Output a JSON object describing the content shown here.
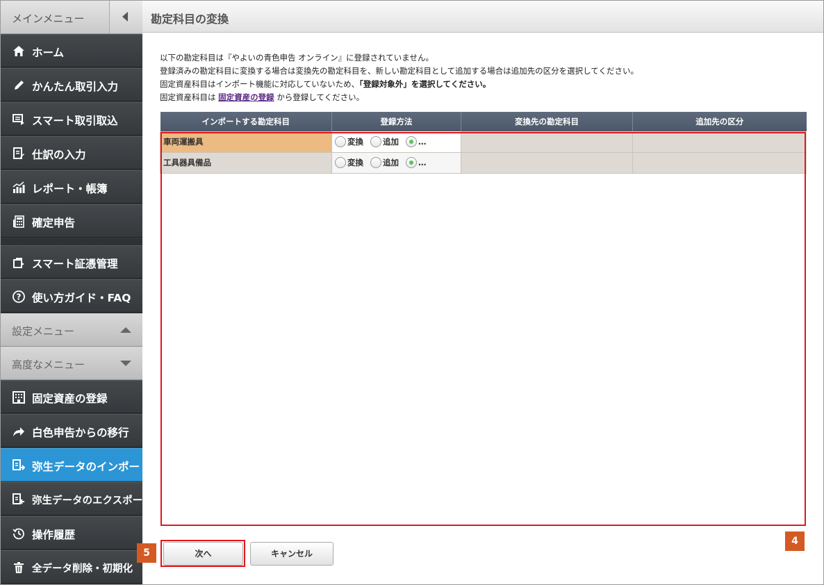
{
  "sidebar": {
    "menu_title": "メインメニュー",
    "items": [
      {
        "label": "ホーム",
        "icon": "home-icon"
      },
      {
        "label": "かんたん取引入力",
        "icon": "pencil-icon"
      },
      {
        "label": "スマート取引取込",
        "icon": "import-icon"
      },
      {
        "label": "仕訳の入力",
        "icon": "journal-icon"
      },
      {
        "label": "レポート・帳簿",
        "icon": "chart-icon"
      },
      {
        "label": "確定申告",
        "icon": "calculator-icon"
      },
      {
        "label": "スマート証憑管理",
        "icon": "receipt-icon"
      },
      {
        "label": "使い方ガイド・FAQ",
        "icon": "help-icon"
      }
    ],
    "settings_title": "設定メニュー",
    "advanced_title": "高度なメニュー",
    "advanced_items": [
      {
        "label": "固定資産の登録",
        "icon": "building-icon"
      },
      {
        "label": "白色申告からの移行",
        "icon": "share-arrow-icon"
      },
      {
        "label": "弥生データのインポート",
        "icon": "data-import-icon"
      },
      {
        "label": "弥生データのエクスポート",
        "icon": "data-export-icon"
      },
      {
        "label": "操作履歴",
        "icon": "history-icon"
      },
      {
        "label": "全データ削除・初期化",
        "icon": "trash-icon"
      }
    ]
  },
  "page": {
    "title": "勘定科目の変換",
    "intro_line1": "以下の勘定科目は『やよいの青色申告 オンライン』に登録されていません。",
    "intro_line2": "登録済みの勘定科目に変換する場合は変換先の勘定科目を、新しい勘定科目として追加する場合は追加先の区分を選択してください。",
    "intro_line3_pre": "固定資産科目はインポート機能に対応していないため、",
    "intro_line3_bold": "「登録対象外」を選択してください。",
    "intro_line4_pre": "固定資産科目は",
    "intro_line4_link": "固定資産の登録",
    "intro_line4_post": "から登録してください。"
  },
  "table": {
    "headers": [
      "インポートする勘定科目",
      "登録方法",
      "変換先の勘定科目",
      "追加先の区分"
    ],
    "rows": [
      {
        "name": "車両運搬具",
        "opt_convert": "変換",
        "opt_add": "追加",
        "opt_other": "…",
        "target": "",
        "category": ""
      },
      {
        "name": "工具器具備品",
        "opt_convert": "変換",
        "opt_add": "追加",
        "opt_other": "…",
        "target": "",
        "category": ""
      }
    ]
  },
  "buttons": {
    "next": "次へ",
    "cancel": "キャンセル"
  },
  "badges": {
    "step4": "4",
    "step5": "5"
  },
  "colors": {
    "accent": "#2b95d5",
    "highlight": "#e5141b",
    "badge": "#d45a23",
    "selected_row": "#edbb82"
  }
}
